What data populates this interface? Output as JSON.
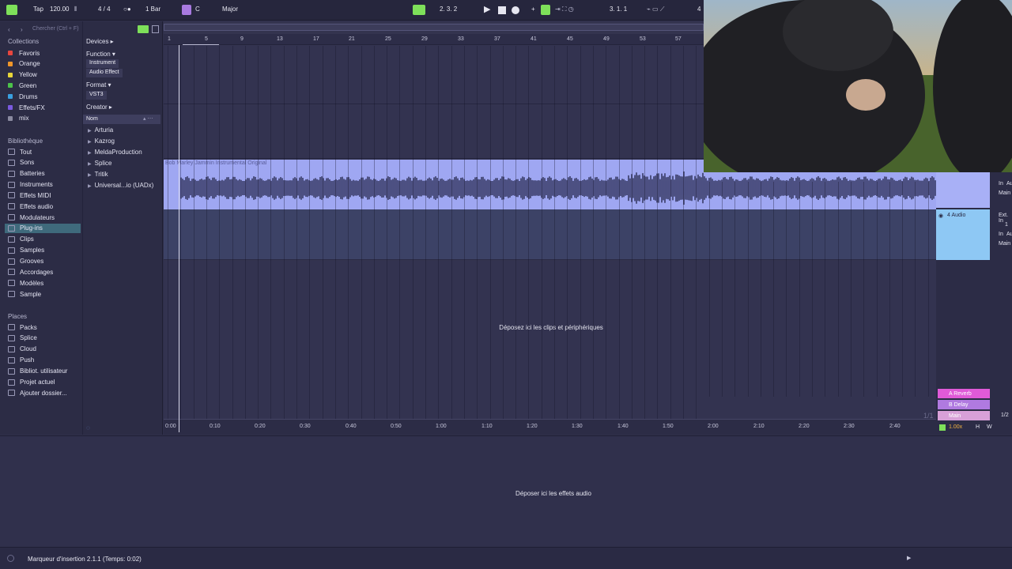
{
  "topbar": {
    "tap_label": "Tap",
    "tempo": "120.00",
    "signature": "4 / 4",
    "metronome": "1 Bar",
    "key": "C",
    "scale": "Major",
    "position": "2.  3.  2",
    "loop_start": "3.  1.  1",
    "loop_end": "4"
  },
  "browser": {
    "search_placeholder": "Chercher (Ctrl + F)",
    "collections_title": "Collections",
    "collections": [
      {
        "label": "Favoris",
        "color": "#e8463e"
      },
      {
        "label": "Orange",
        "color": "#f0962a"
      },
      {
        "label": "Yellow",
        "color": "#e6d43a"
      },
      {
        "label": "Green",
        "color": "#4cc24a"
      },
      {
        "label": "Drums",
        "color": "#3aa0e0"
      },
      {
        "label": "Effets/FX",
        "color": "#7a5ae0"
      },
      {
        "label": "mix",
        "color": "#8a8aa0"
      }
    ],
    "library_title": "Bibliothèque",
    "library": [
      "Tout",
      "Sons",
      "Batteries",
      "Instruments",
      "Effets MIDI",
      "Effets audio",
      "Modulateurs",
      "Plug-ins",
      "Clips",
      "Samples",
      "Grooves",
      "Accordages",
      "Modèles",
      "Sample"
    ],
    "places_title": "Places",
    "places": [
      "Packs",
      "Splice",
      "Cloud",
      "Push",
      "Bibliot. utilisateur",
      "Projet actuel",
      "Ajouter dossier..."
    ],
    "filters": {
      "devices": "Devices ▸",
      "function": "Function ▾",
      "instrument": "Instrument",
      "audio_effect": "Audio Effect",
      "format": "Format ▾",
      "vst3": "VST3",
      "creator": "Creator ▸",
      "name_header": "Nom"
    },
    "plugins": [
      "Arturia",
      "Kazrog",
      "MeldaProduction",
      "Splice",
      "Tritik",
      "Universal...io (UADx)"
    ]
  },
  "arrangement": {
    "bar_numbers": [
      "1",
      "5",
      "9",
      "13",
      "17",
      "21",
      "25",
      "29",
      "33",
      "37",
      "41",
      "45",
      "49",
      "53",
      "57"
    ],
    "clip_title": "Bob Marley Jammin Instrumental Original",
    "drop_clips": "Déposez ici les clips et périphériques",
    "time_labels": [
      "0:00",
      "0:10",
      "0:20",
      "0:30",
      "0:40",
      "0:50",
      "1:00",
      "1:10",
      "1:20",
      "1:30",
      "1:40",
      "1:50",
      "2:00",
      "2:10",
      "2:20",
      "2:30",
      "2:40"
    ]
  },
  "mixer": {
    "track_name": "4 Audio",
    "in_label": "In",
    "au_label": "Au",
    "main_label": "Main",
    "ext_in": "Ext. In",
    "returns": [
      {
        "label": "A Reverb",
        "color": "#e05ad8"
      },
      {
        "label": "B Delay",
        "color": "#b07ae0"
      },
      {
        "label": "Main",
        "color": "#d8a0d8"
      }
    ],
    "page_left": "1/1",
    "page_right": "1/2",
    "zoom": "1.00x",
    "h_label": "H",
    "w_label": "W",
    "ch_one": "1"
  },
  "device_view": {
    "drop_fx": "Déposer ici les effets audio"
  },
  "status": {
    "text": "Marqueur d'insertion 2.1.1 (Temps: 0:02)"
  }
}
